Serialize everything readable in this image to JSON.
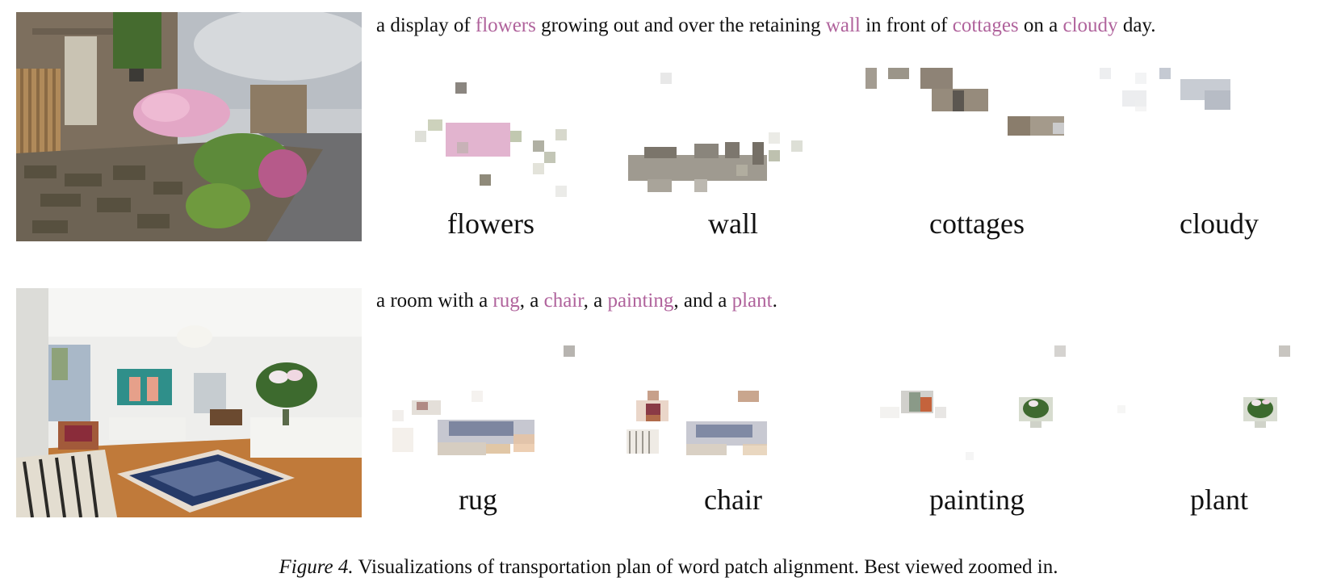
{
  "row1": {
    "caption_parts": [
      {
        "text": "a display of ",
        "highlight": false
      },
      {
        "text": "flowers",
        "highlight": true
      },
      {
        "text": " growing out and over the retaining ",
        "highlight": false
      },
      {
        "text": "wall",
        "highlight": true
      },
      {
        "text": " in front of ",
        "highlight": false
      },
      {
        "text": "cottages",
        "highlight": true
      },
      {
        "text": " on a ",
        "highlight": false
      },
      {
        "text": "cloudy",
        "highlight": true
      },
      {
        "text": " day.",
        "highlight": false
      }
    ],
    "words": [
      "flowers",
      "wall",
      "cottages",
      "cloudy"
    ]
  },
  "row2": {
    "caption_parts": [
      {
        "text": "a room with a ",
        "highlight": false
      },
      {
        "text": "rug",
        "highlight": true
      },
      {
        "text": ", a ",
        "highlight": false
      },
      {
        "text": "chair",
        "highlight": true
      },
      {
        "text": ", a ",
        "highlight": false
      },
      {
        "text": "painting",
        "highlight": true
      },
      {
        "text": ", and a ",
        "highlight": false
      },
      {
        "text": "plant",
        "highlight": true
      },
      {
        "text": ".",
        "highlight": false
      }
    ],
    "words": [
      "rug",
      "chair",
      "painting",
      "plant"
    ]
  },
  "figure_caption": {
    "label": "Figure 4.",
    "text": " Visualizations of transportation plan of word patch alignment. Best viewed zoomed in."
  },
  "colors": {
    "highlight": "#b0639c"
  }
}
